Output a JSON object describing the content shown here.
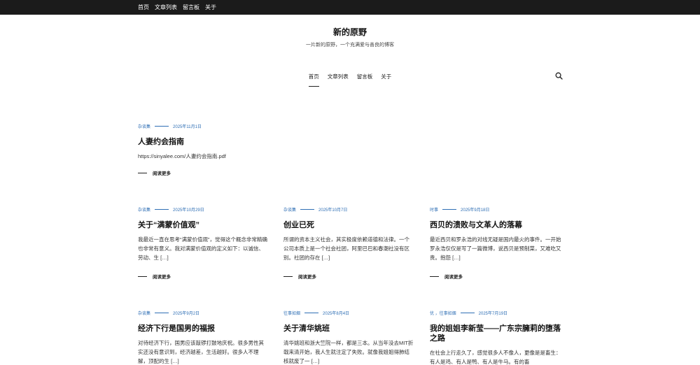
{
  "topbar": {
    "items": [
      "首页",
      "文章列表",
      "留言板",
      "关于"
    ]
  },
  "site": {
    "title": "新的原野",
    "description": "一片新的原野，一个充满爱与善良的博客"
  },
  "nav": {
    "items": [
      "首页",
      "文章列表",
      "留言板",
      "关于"
    ],
    "active": "首页"
  },
  "read_more": "阅读更多",
  "posts": [
    {
      "category": "杂谈集",
      "date": "2025年11月1日",
      "title": "人妻约会指南",
      "excerpt": "https://sinyalee.com/人妻约会指南.pdf"
    },
    {
      "category": "杂谈集",
      "date": "2025年10月29日",
      "title": "关于“满蒙价值观”",
      "excerpt": "我最近一直在思考“满蒙价值观”，觉得这个概念非常精确也非常有意义。我对满蒙价值观的定义如下：以诚信、劳动、生 […]"
    },
    {
      "category": "杂谈集",
      "date": "2025年10月7日",
      "title": "创业已死",
      "excerpt": "所谓的资本主义社会，其实极度依赖道德和法律。一个公司本质上是一个社会社团，阿里巴巴和春潮社没有区别。社团的存在 […]"
    },
    {
      "category": "时事",
      "date": "2025年9月18日",
      "title": "西贝的溃败与文革人的落幕",
      "excerpt": "最近西贝和罗永浩的对线无疑是国内最火的事件。一开始罗永浩仅仅是写了一篇微博，说西贝是预制菜，又难吃又贵。抱怨 […]"
    },
    {
      "category": "杂谈集",
      "date": "2025年9月2日",
      "title": "经济下行是国男的福报",
      "excerpt": "对待经济下行，国男应该敲锣打鼓地庆祝。很多男性其实还没有意识到，经济越差，生活越好。很多人不理解，顶配的生 […]"
    },
    {
      "category": "往事如烟",
      "date": "2025年8月4日",
      "title": "关于清华姚班",
      "excerpt": "清华姚班和浙大竺院一样，都是三本。从当年没去MIT折戟来清开始，我人生就注定了失败。就像我姐姐得肺结核就废了一 […]"
    },
    {
      "category": "优 ，往事如烟",
      "date": "2025年7月19日",
      "title": "我的姐姐李新莹——广东宗臃莉的堕落之路",
      "excerpt": "在社会上行走久了，感觉很多人不像人，更像是是畜生：有人是鸡、有人是鸭、有人是牛马。有的畜"
    }
  ]
}
